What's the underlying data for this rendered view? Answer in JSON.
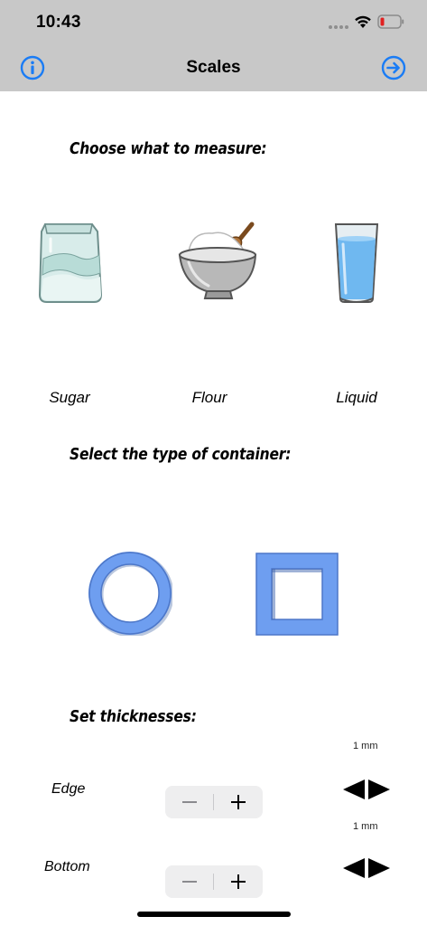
{
  "status": {
    "time": "10:43",
    "signal_icon": "signal-dots-icon",
    "wifi_icon": "wifi-icon",
    "battery_icon": "battery-low-icon"
  },
  "nav": {
    "title": "Scales",
    "left_icon": "info-icon",
    "right_icon": "arrow-right-circle-icon",
    "accent_color": "#1a7cf5"
  },
  "measure": {
    "heading": "Choose what to measure:",
    "items": [
      {
        "label": "Sugar",
        "icon": "sugar-bag-icon"
      },
      {
        "label": "Flour",
        "icon": "flour-bowl-icon"
      },
      {
        "label": "Liquid",
        "icon": "water-glass-icon"
      }
    ]
  },
  "container": {
    "heading": "Select the type of container:",
    "options": [
      {
        "icon": "round-container-icon"
      },
      {
        "icon": "square-container-icon"
      }
    ],
    "color": "#6e9ef0"
  },
  "thickness": {
    "heading": "Set thicknesses:",
    "rows": [
      {
        "label": "Edge",
        "unit": "1 mm"
      },
      {
        "label": "Bottom",
        "unit": "1 mm"
      }
    ]
  }
}
